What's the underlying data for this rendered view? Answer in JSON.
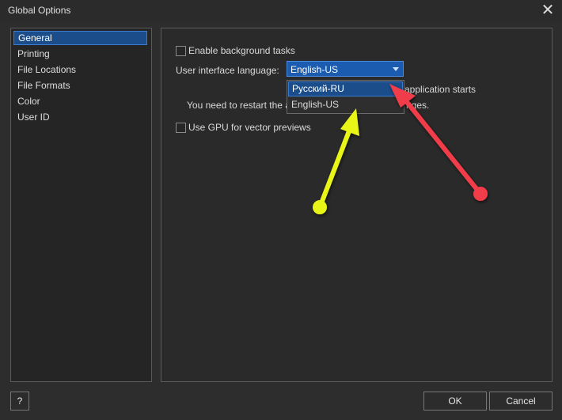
{
  "window": {
    "title": "Global Options",
    "close_icon": "close-icon"
  },
  "sidebar": {
    "items": [
      {
        "label": "General",
        "selected": true
      },
      {
        "label": "Printing"
      },
      {
        "label": "File Locations"
      },
      {
        "label": "File Formats"
      },
      {
        "label": "Color"
      },
      {
        "label": "User ID"
      }
    ]
  },
  "general": {
    "background_tasks_label": "Enable background tasks",
    "background_tasks_checked": false,
    "language_label": "User interface language:",
    "language_value": "English-US",
    "language_options": [
      "Русский-RU",
      "English-US"
    ],
    "highlighted_option": "Русский-RU",
    "restart_note_tail": "application starts",
    "restart_note_start": "You need to restart the a",
    "restart_note_end": "nges.",
    "gpu_label": "Use GPU for vector previews",
    "gpu_checked": false
  },
  "footer": {
    "help_label": "?",
    "ok_label": "OK",
    "cancel_label": "Cancel"
  },
  "annotations": {
    "yellow_arrow_color": "#e8f514",
    "red_arrow_color": "#f03c4a"
  }
}
